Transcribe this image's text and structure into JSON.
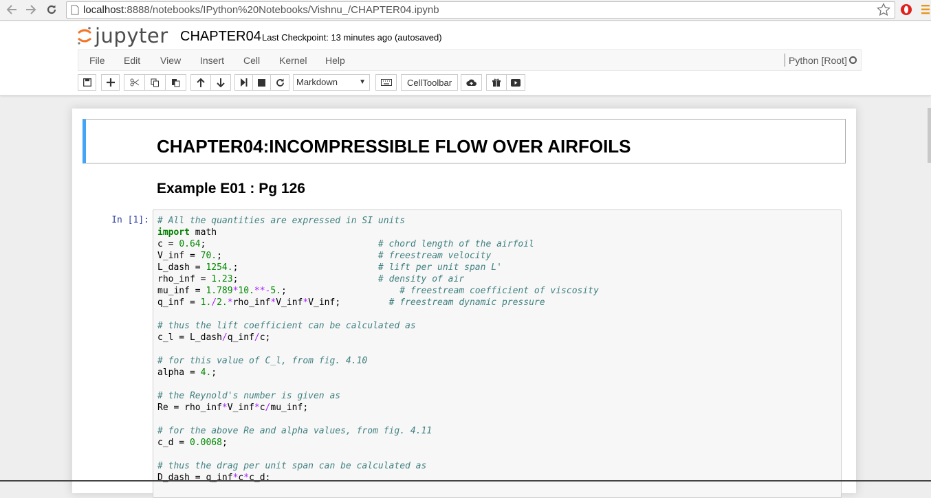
{
  "browser": {
    "url_host": "localhost",
    "url_rest": ":8888/notebooks/IPython%20Notebooks/Vishnu_/CHAPTER04.ipynb"
  },
  "header": {
    "logo_text": "jupyter",
    "notebook_title": "CHAPTER04",
    "checkpoint": "Last Checkpoint: 13 minutes ago (autosaved)"
  },
  "menu": {
    "items": [
      "File",
      "Edit",
      "View",
      "Insert",
      "Cell",
      "Kernel",
      "Help"
    ],
    "kernel_name": "Python [Root]"
  },
  "toolbar": {
    "cell_type_selected": "Markdown",
    "celltoolbar_label": "CellToolbar"
  },
  "notebook": {
    "heading1": "CHAPTER04:INCOMPRESSIBLE FLOW OVER AIRFOILS",
    "heading2": "Example E01 : Pg 126",
    "prompt": "In [1]:"
  },
  "colors": {
    "accent_blue": "#42a5f5",
    "prompt_blue": "#303f9f",
    "comment": "#408080",
    "keyword": "#008000",
    "operator": "#aa22ff"
  },
  "code": [
    [
      [
        "c-com",
        "# All the quantities are expressed in SI units"
      ]
    ],
    [
      [
        "c-kw",
        "import"
      ],
      [
        "",
        " math"
      ]
    ],
    [
      [
        "",
        "c = "
      ],
      [
        "c-num",
        "0.64"
      ],
      [
        "",
        ";                                "
      ],
      [
        "c-com",
        "# chord length of the airfoil"
      ]
    ],
    [
      [
        "",
        "V_inf = "
      ],
      [
        "c-num",
        "70."
      ],
      [
        "",
        ";                             "
      ],
      [
        "c-com",
        "# freestream velocity"
      ]
    ],
    [
      [
        "",
        "L_dash = "
      ],
      [
        "c-num",
        "1254."
      ],
      [
        "",
        ";                          "
      ],
      [
        "c-com",
        "# lift per unit span L'"
      ]
    ],
    [
      [
        "",
        "rho_inf = "
      ],
      [
        "c-num",
        "1.23"
      ],
      [
        "",
        ";                          "
      ],
      [
        "c-com",
        "# density of air"
      ]
    ],
    [
      [
        "",
        "mu_inf = "
      ],
      [
        "c-num",
        "1.789"
      ],
      [
        "c-op",
        "*"
      ],
      [
        "c-num",
        "10."
      ],
      [
        "c-op",
        "**-"
      ],
      [
        "c-num",
        "5."
      ],
      [
        "",
        ";                     "
      ],
      [
        "c-com",
        "# freestream coefficient of viscosity"
      ]
    ],
    [
      [
        "",
        "q_inf = "
      ],
      [
        "c-num",
        "1."
      ],
      [
        "c-op",
        "/"
      ],
      [
        "c-num",
        "2."
      ],
      [
        "c-op",
        "*"
      ],
      [
        "",
        "rho_inf"
      ],
      [
        "c-op",
        "*"
      ],
      [
        "",
        "V_inf"
      ],
      [
        "c-op",
        "*"
      ],
      [
        "",
        "V_inf;         "
      ],
      [
        "c-com",
        "# freestream dynamic pressure"
      ]
    ],
    [],
    [
      [
        "c-com",
        "# thus the lift coefficient can be calculated as"
      ]
    ],
    [
      [
        "",
        "c_l = L_dash"
      ],
      [
        "c-op",
        "/"
      ],
      [
        "",
        "q_inf"
      ],
      [
        "c-op",
        "/"
      ],
      [
        "",
        "c;"
      ]
    ],
    [],
    [
      [
        "c-com",
        "# for this value of C_l, from fig. 4.10"
      ]
    ],
    [
      [
        "",
        "alpha = "
      ],
      [
        "c-num",
        "4."
      ],
      [
        "",
        ";"
      ]
    ],
    [],
    [
      [
        "c-com",
        "# the Reynold's number is given as"
      ]
    ],
    [
      [
        "",
        "Re = rho_inf"
      ],
      [
        "c-op",
        "*"
      ],
      [
        "",
        "V_inf"
      ],
      [
        "c-op",
        "*"
      ],
      [
        "",
        "c"
      ],
      [
        "c-op",
        "/"
      ],
      [
        "",
        "mu_inf;"
      ]
    ],
    [],
    [
      [
        "c-com",
        "# for the above Re and alpha values, from fig. 4.11"
      ]
    ],
    [
      [
        "",
        "c_d = "
      ],
      [
        "c-num",
        "0.0068"
      ],
      [
        "",
        ";"
      ]
    ],
    [],
    [
      [
        "c-com",
        "# thus the drag per unit span can be calculated as"
      ]
    ],
    [
      [
        "",
        "D_dash = q_inf"
      ],
      [
        "c-op",
        "*"
      ],
      [
        "",
        "c"
      ],
      [
        "c-op",
        "*"
      ],
      [
        "",
        "c_d;"
      ]
    ]
  ]
}
